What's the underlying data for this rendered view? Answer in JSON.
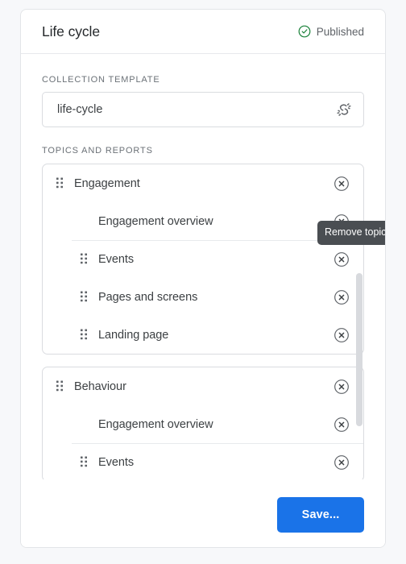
{
  "header": {
    "title": "Life cycle",
    "status": {
      "label": "Published",
      "icon": "check-circle-icon",
      "color": "#188038"
    }
  },
  "collection_template": {
    "label": "Collection template",
    "value": "life-cycle",
    "placeholder": "Collection template",
    "trailing_icon": "spinner-icon"
  },
  "topics_section": {
    "label": "Topics and reports",
    "cards": [
      {
        "name": "engagement-topic-card",
        "rows": [
          {
            "label": "Engagement",
            "level": "topic",
            "handle": true,
            "divider": false,
            "remove_label": "Remove topic"
          },
          {
            "label": "Engagement overview",
            "level": "report",
            "handle": false,
            "divider": false,
            "remove_label": "Remove report"
          },
          {
            "label": "Events",
            "level": "report",
            "handle": true,
            "divider": true,
            "remove_label": "Remove report"
          },
          {
            "label": "Pages and screens",
            "level": "report",
            "handle": true,
            "divider": false,
            "remove_label": "Remove report"
          },
          {
            "label": "Landing page",
            "level": "report",
            "handle": true,
            "divider": false,
            "remove_label": "Remove report"
          }
        ]
      },
      {
        "name": "behaviour-topic-card",
        "rows": [
          {
            "label": "Behaviour",
            "level": "topic",
            "handle": true,
            "divider": false,
            "remove_label": "Remove topic"
          },
          {
            "label": "Engagement overview",
            "level": "report",
            "handle": false,
            "divider": false,
            "remove_label": "Remove report"
          },
          {
            "label": "Events",
            "level": "report",
            "handle": true,
            "divider": true,
            "remove_label": "Remove report"
          }
        ]
      }
    ]
  },
  "tooltip": {
    "text": "Remove topic",
    "background": "#4a4e52"
  },
  "footer": {
    "save_label": "Save...",
    "save_color": "#1a73e8"
  },
  "scrollbar": {
    "orientation": "vertical",
    "thumb_color": "#d8dade"
  }
}
